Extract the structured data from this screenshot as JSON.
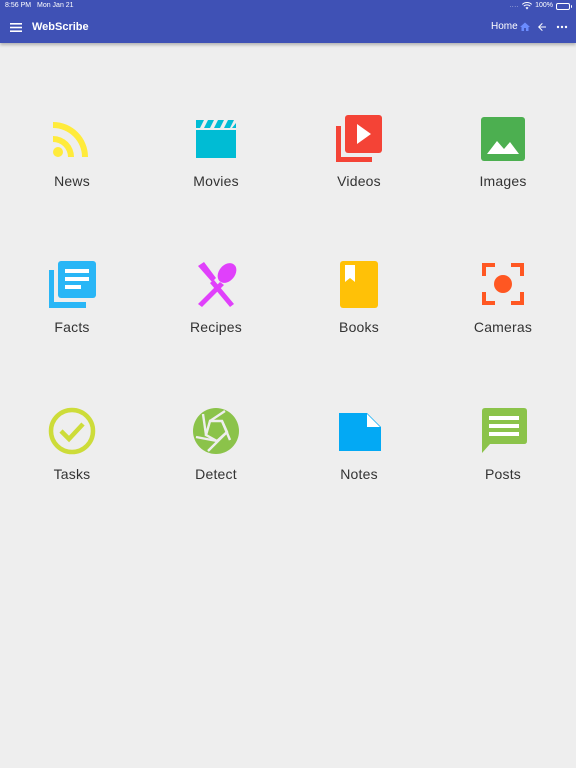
{
  "status_bar": {
    "time": "8:56 PM",
    "date": "Mon Jan 21",
    "signal_dots": "....",
    "battery": "100%",
    "battery_level": 1.0
  },
  "app_bar": {
    "title": "WebScribe",
    "home_label": "Home",
    "icons": [
      "menu-icon",
      "home-icon",
      "back-arrow-icon",
      "more-icon"
    ],
    "color": "#3f51b5"
  },
  "tiles": [
    {
      "label": "News",
      "icon": "rss-icon",
      "color": "#ffeb3b"
    },
    {
      "label": "Movies",
      "icon": "clapperboard-icon",
      "color": "#00bcd4"
    },
    {
      "label": "Videos",
      "icon": "video-library-icon",
      "color": "#f44336"
    },
    {
      "label": "Images",
      "icon": "image-icon",
      "color": "#4caf50"
    },
    {
      "label": "Facts",
      "icon": "library-books-icon",
      "color": "#29b6f6"
    },
    {
      "label": "Recipes",
      "icon": "fork-spoon-icon",
      "color": "#e040fb"
    },
    {
      "label": "Books",
      "icon": "book-icon",
      "color": "#ffc107"
    },
    {
      "label": "Cameras",
      "icon": "camera-focus-icon",
      "color": "#ff5722"
    },
    {
      "label": "Tasks",
      "icon": "check-circle-icon",
      "color": "#cddc39"
    },
    {
      "label": "Detect",
      "icon": "aperture-icon",
      "color": "#8bc34a"
    },
    {
      "label": "Notes",
      "icon": "note-icon",
      "color": "#03a9f4"
    },
    {
      "label": "Posts",
      "icon": "chat-icon",
      "color": "#8bc34a"
    }
  ]
}
